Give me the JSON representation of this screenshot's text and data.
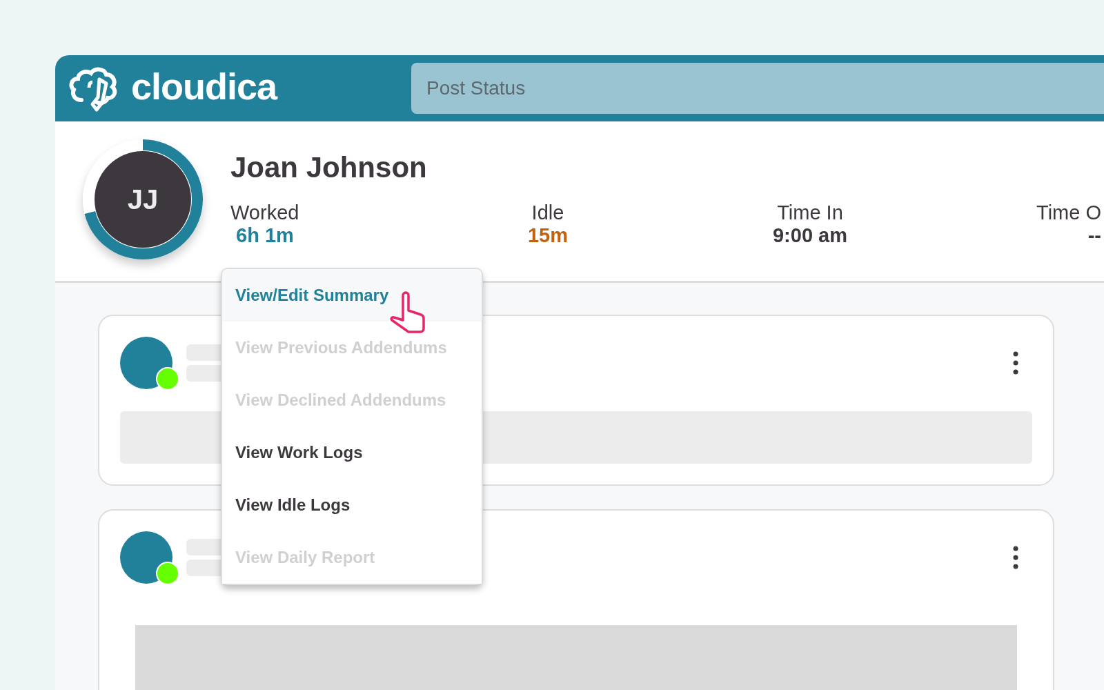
{
  "header": {
    "logo": "cloudica",
    "search": {
      "placeholder": "Post Status"
    }
  },
  "profile": {
    "initials": "JJ",
    "name": "Joan Johnson",
    "level": 0.71,
    "stats": [
      {
        "label": "Worked",
        "value": "6h 1m",
        "color": "#22819a"
      },
      {
        "label": "Idle",
        "value": "15m",
        "color": "#c2620c"
      },
      {
        "label": "Time In",
        "value": "9:00 am",
        "color": "#3d383e"
      },
      {
        "label": "Time O",
        "value": "--",
        "color": "#3d383e"
      }
    ]
  },
  "menu": {
    "items": [
      {
        "label": "View/Edit Summary",
        "selected": true,
        "disabled": false
      },
      {
        "label": "View Previous Addendums",
        "selected": false,
        "disabled": true
      },
      {
        "label": "View Declined Addendums",
        "selected": false,
        "disabled": true
      },
      {
        "label": "View Work Logs",
        "selected": false,
        "disabled": false
      },
      {
        "label": "View Idle Logs",
        "selected": false,
        "disabled": false
      },
      {
        "label": "View Daily Report",
        "selected": false,
        "disabled": true
      }
    ]
  },
  "posts": [
    {
      "online": true
    },
    {
      "online": true
    }
  ]
}
